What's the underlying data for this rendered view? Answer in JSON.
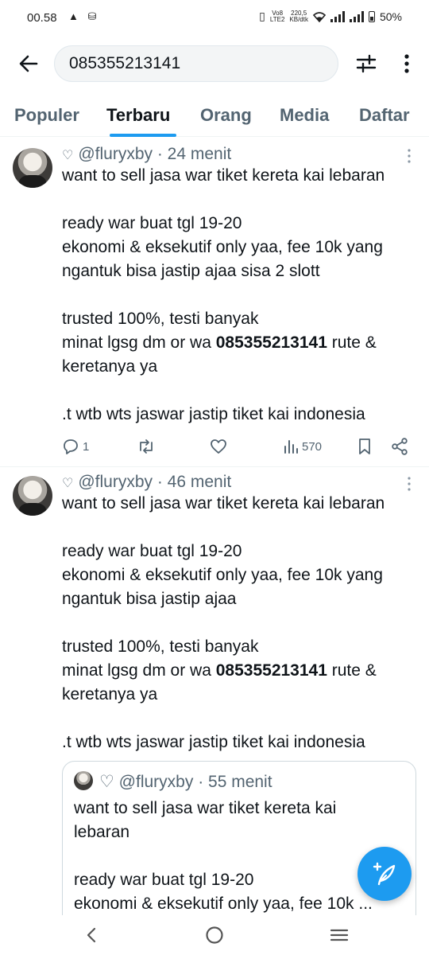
{
  "status_bar": {
    "time": "00.58",
    "left_icons": "▲ ⛁",
    "network_top": "Vo8",
    "network_bottom": "LTE2",
    "speed_value": "220,5",
    "speed_unit": "KB/dtk",
    "battery": "50%"
  },
  "search": {
    "query": "085355213141"
  },
  "tabs": [
    {
      "label": "Populer"
    },
    {
      "label": "Terbaru"
    },
    {
      "label": "Orang"
    },
    {
      "label": "Media"
    },
    {
      "label": "Daftar"
    }
  ],
  "tweets": [
    {
      "handle": "@fluryxby",
      "time": "· 24 menit",
      "lines": [
        "want to sell jasa war tiket kereta kai lebaran",
        "",
        "ready war buat tgl 19-20",
        "ekonomi & eksekutif only yaa, fee 10k yang",
        "ngantuk bisa jastip ajaa sisa 2 slott",
        "",
        "trusted 100%, testi banyak"
      ],
      "phone_prefix": "minat lgsg dm or wa ",
      "phone": "085355213141",
      "phone_suffix": " rute &",
      "after_lines": [
        "keretanya ya",
        "",
        ".t wtb wts jaswar jastip tiket kai indonesia"
      ],
      "replies": "1",
      "views": "570"
    },
    {
      "handle": "@fluryxby",
      "time": "· 46 menit",
      "lines": [
        "want to sell jasa war tiket kereta kai lebaran",
        "",
        "ready war buat tgl 19-20",
        "ekonomi & eksekutif only yaa, fee 10k yang",
        "ngantuk bisa jastip ajaa",
        "",
        "trusted 100%, testi banyak"
      ],
      "phone_prefix": "minat lgsg dm or wa ",
      "phone": "085355213141",
      "phone_suffix": " rute &",
      "after_lines": [
        "keretanya ya",
        "",
        ".t wtb wts jaswar jastip tiket kai indonesia"
      ],
      "quote": {
        "handle": "@fluryxby",
        "time": "· 55 menit",
        "lines": [
          "want to sell jasa war tiket kereta kai",
          "lebaran",
          "",
          "ready war buat tgl 19-20",
          "ekonomi & eksekutif only yaa, fee 10k ..."
        ]
      }
    }
  ],
  "colors": {
    "accent": "#1d9bf0",
    "text": "#0f1419",
    "secondary": "#536471"
  }
}
